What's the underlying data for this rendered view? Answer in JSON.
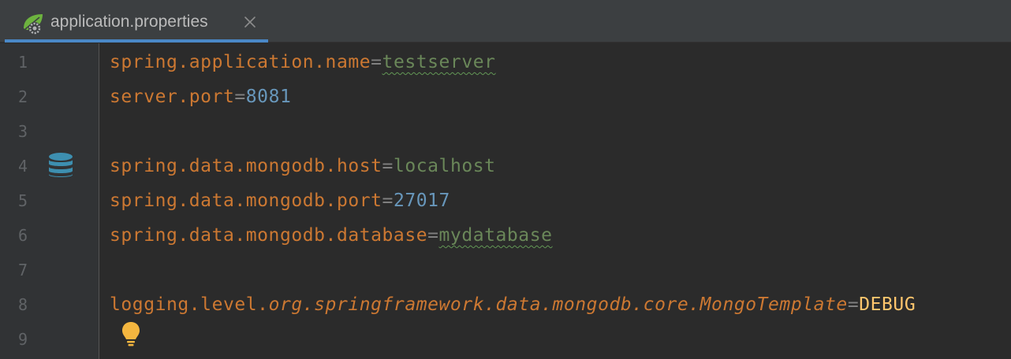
{
  "tab": {
    "label": "application.properties",
    "icon": "spring-leaf-settings-icon",
    "close_icon": "close-icon"
  },
  "gutter": {
    "line_numbers": [
      "1",
      "2",
      "3",
      "4",
      "5",
      "6",
      "7",
      "8",
      "9"
    ],
    "db_icon": "database-icon",
    "db_icon_line": "4"
  },
  "colors": {
    "key": "#cc7832",
    "separator": "#808080",
    "string_value": "#6a8759",
    "number_value": "#6897bb",
    "constant_value": "#ffc66d",
    "tab_underline": "#4a88c7",
    "bulb": "#f4b63f"
  },
  "code": {
    "line1": {
      "key": "spring.application.name",
      "eq": "=",
      "value": "testserver"
    },
    "line2": {
      "key": "server.port",
      "eq": "=",
      "value": "8081"
    },
    "line3": {
      "text": ""
    },
    "line4": {
      "key": "spring.data.mongodb.host",
      "eq": "=",
      "value": "localhost"
    },
    "line5": {
      "key": "spring.data.mongodb.port",
      "eq": "=",
      "value": "27017"
    },
    "line6": {
      "key": "spring.data.mongodb.database",
      "eq": "=",
      "value": "mydatabase"
    },
    "line7": {
      "text": ""
    },
    "line8": {
      "key_prefix": "logging.level.",
      "key_italic": "org.springframework.data.mongodb.core.MongoTemplate",
      "eq": "=",
      "value": "DEBUG"
    },
    "line9": {
      "text": ""
    }
  },
  "intention_action": "lightbulb-icon"
}
